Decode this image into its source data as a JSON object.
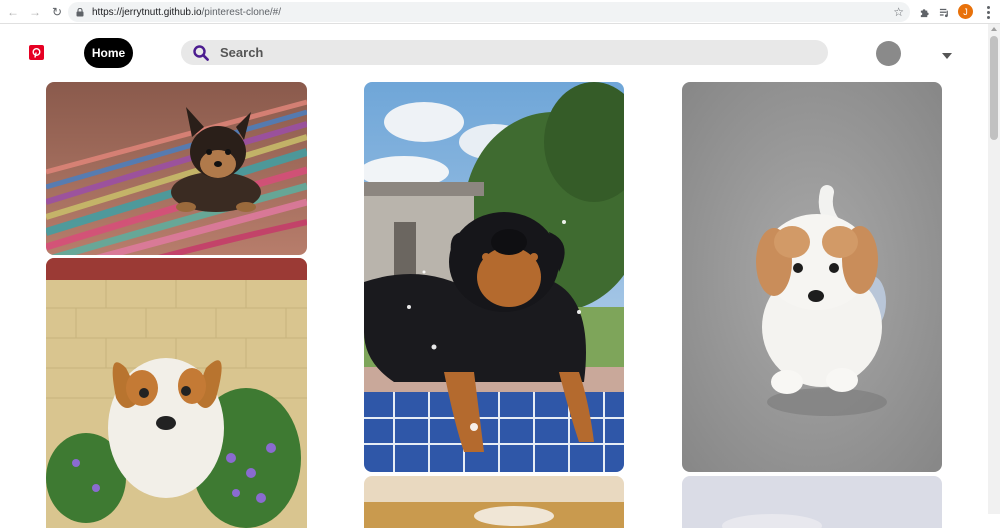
{
  "browser": {
    "url_host": "https://jerrytnutt.github.io",
    "url_path": "/pinterest-clone/#/",
    "profile_initial": "J"
  },
  "header": {
    "home_label": "Home",
    "search_placeholder": "Search",
    "brand_color": "#e60023",
    "accent_color": "#000000"
  },
  "pins": [
    {
      "subject": "yorkie puppy on colorful rug"
    },
    {
      "subject": "black and tan puppy on pool edge"
    },
    {
      "subject": "cavapoo puppy on gray background"
    },
    {
      "subject": "jack russell puppy by flowers"
    },
    {
      "subject": "puppy photo partially visible"
    },
    {
      "subject": "puppy photo partially visible"
    }
  ]
}
